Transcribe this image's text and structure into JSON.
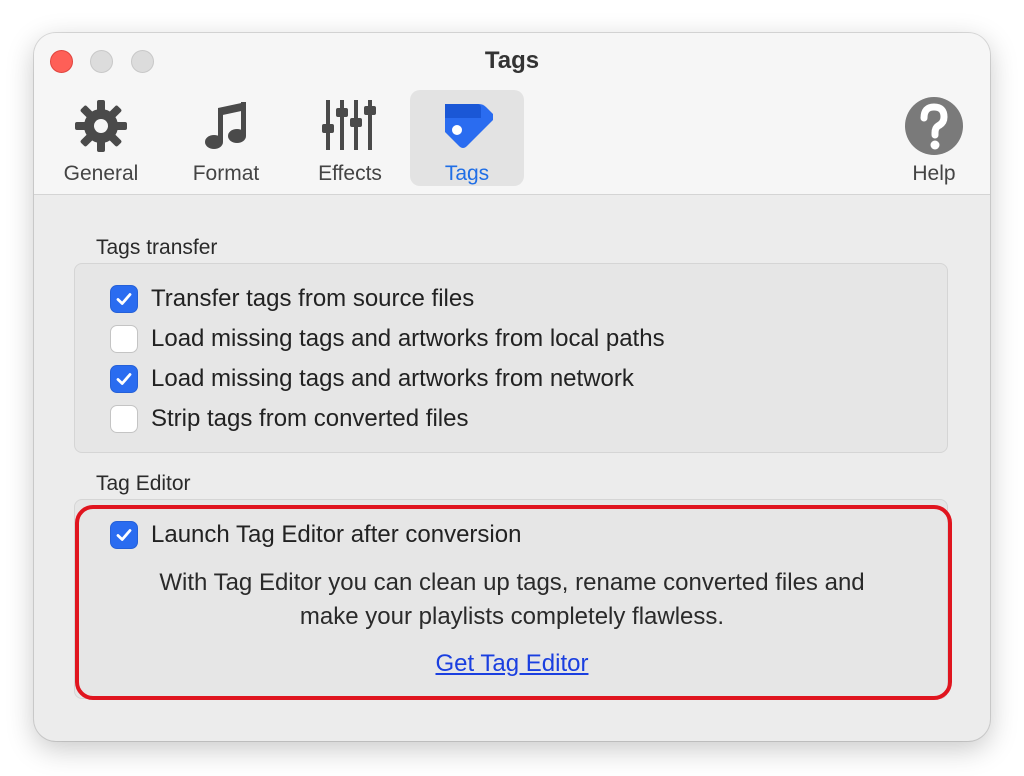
{
  "window": {
    "title": "Tags",
    "controls": {
      "close": "close-button",
      "minimize": "minimize-button",
      "zoom": "zoom-button"
    }
  },
  "toolbar": {
    "tabs": [
      {
        "label": "General",
        "icon": "gear-icon",
        "selected": false
      },
      {
        "label": "Format",
        "icon": "music-note-icon",
        "selected": false
      },
      {
        "label": "Effects",
        "icon": "sliders-icon",
        "selected": false
      },
      {
        "label": "Tags",
        "icon": "tag-icon",
        "selected": true
      }
    ],
    "help": {
      "label": "Help",
      "icon": "question-icon"
    }
  },
  "tags_transfer": {
    "title": "Tags transfer",
    "options": [
      {
        "label": "Transfer tags from source files",
        "checked": true
      },
      {
        "label": "Load missing tags and artworks from local paths",
        "checked": false
      },
      {
        "label": "Load missing tags and artworks from network",
        "checked": true
      },
      {
        "label": "Strip tags from converted files",
        "checked": false
      }
    ]
  },
  "tag_editor": {
    "title": "Tag Editor",
    "launch_option": {
      "label": "Launch Tag Editor after conversion",
      "checked": true
    },
    "description_line1": "With Tag Editor you can clean up tags, rename converted files and",
    "description_line2": "make your playlists completely flawless.",
    "link_label": "Get Tag Editor"
  },
  "colors": {
    "accent": "#2a6cf0",
    "selected_tab_text": "#1f6ee6",
    "link": "#1a3fe0",
    "highlight_outline": "#e0151f",
    "close_button": "#fe5f57"
  }
}
